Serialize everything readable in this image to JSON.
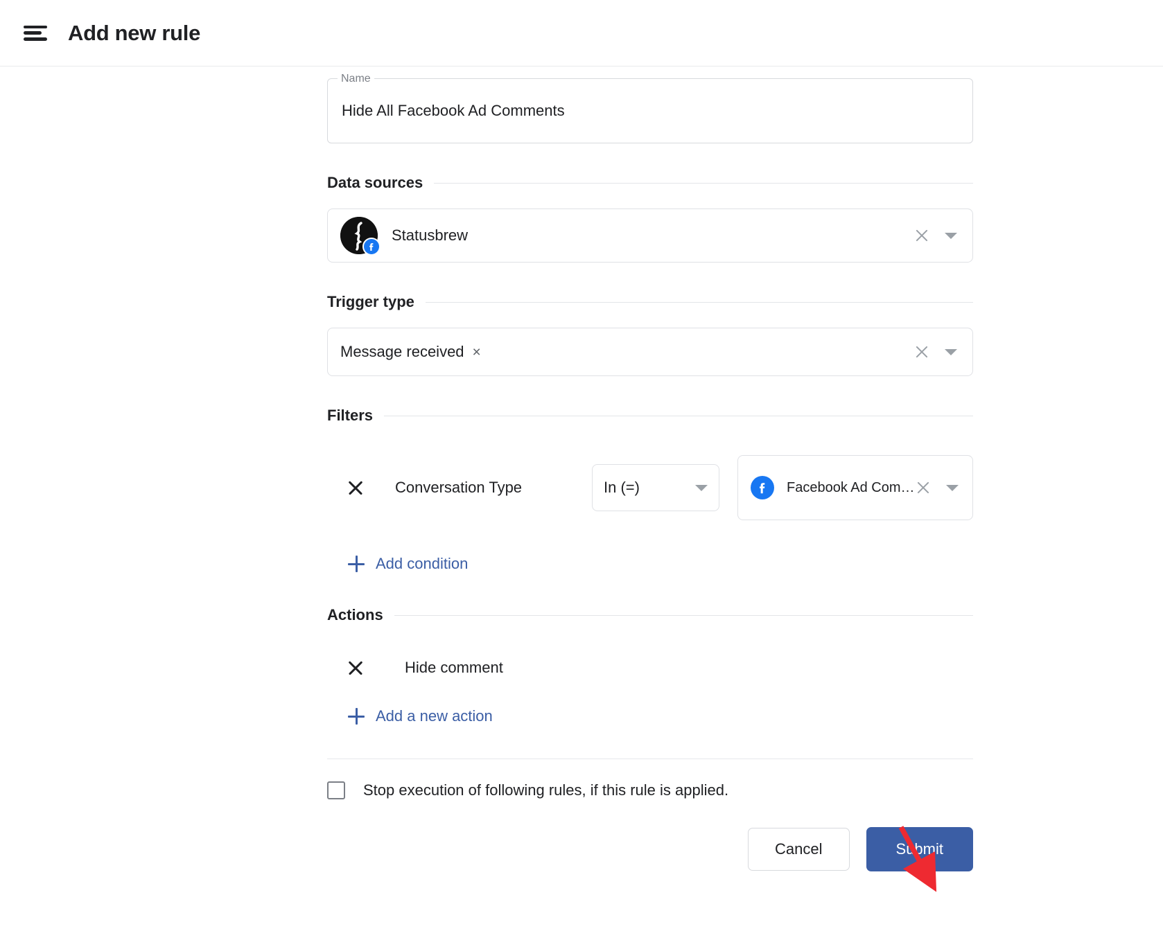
{
  "header": {
    "menu_icon": "hamburger-menu-icon",
    "title": "Add new rule"
  },
  "form": {
    "name_field": {
      "label": "Name",
      "value": "Hide All Facebook Ad Comments",
      "placeholder": "Name"
    },
    "data_sources": {
      "section_title": "Data sources",
      "selected": {
        "name": "Statusbrew",
        "network_badge_icon": "facebook-icon"
      },
      "clear_icon": "clear-icon",
      "dropdown_icon": "chevron-down-icon"
    },
    "trigger_type": {
      "section_title": "Trigger type",
      "chip": {
        "label": "Message received",
        "remove_icon": "close-icon"
      },
      "clear_icon": "clear-icon",
      "dropdown_icon": "chevron-down-icon"
    },
    "filters": {
      "section_title": "Filters",
      "conditions": [
        {
          "remove_icon": "close-icon",
          "field": "Conversation Type",
          "operator": "In (=)",
          "operator_dropdown_icon": "chevron-down-icon",
          "value": "Facebook Ad Comment",
          "value_icon": "facebook-icon"
        }
      ],
      "add_condition_label": "Add condition",
      "add_condition_icon": "plus-icon"
    },
    "actions": {
      "section_title": "Actions",
      "items": [
        {
          "remove_icon": "close-icon",
          "label": "Hide comment"
        }
      ],
      "add_action_label": "Add a new action",
      "add_action_icon": "plus-icon"
    },
    "stop_execution": {
      "checked": false,
      "label": "Stop execution of following rules, if this rule is applied."
    },
    "buttons": {
      "cancel_label": "Cancel",
      "submit_label": "Submit"
    }
  },
  "annotation": {
    "arrow_icon": "red-arrow-pointer",
    "color": "#ee2a31"
  },
  "colors": {
    "accent_blue": "#3b5ea5",
    "link_blue": "#3b5ea5",
    "facebook_blue": "#1877f2",
    "annotation_red": "#ee2a31",
    "border": "#dfe1e5",
    "text": "#202124",
    "muted_text": "#7b7f86"
  }
}
